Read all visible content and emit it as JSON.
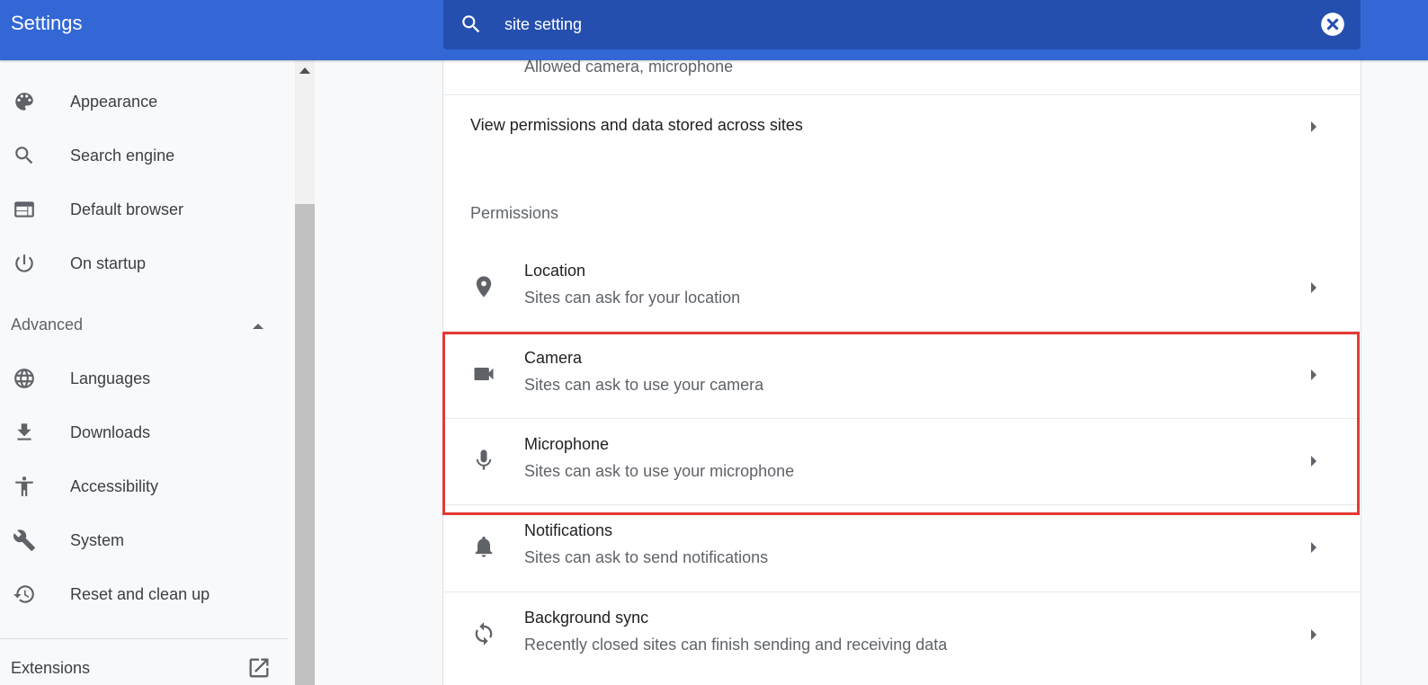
{
  "header": {
    "title": "Settings",
    "search_value": "site setting"
  },
  "sidebar": {
    "items_top": [
      {
        "label": "Appearance",
        "icon": "palette-icon"
      },
      {
        "label": "Search engine",
        "icon": "search-icon"
      },
      {
        "label": "Default browser",
        "icon": "browser-icon"
      },
      {
        "label": "On startup",
        "icon": "power-icon"
      }
    ],
    "advanced_label": "Advanced",
    "items_advanced": [
      {
        "label": "Languages",
        "icon": "globe-icon"
      },
      {
        "label": "Downloads",
        "icon": "download-icon"
      },
      {
        "label": "Accessibility",
        "icon": "accessibility-icon"
      },
      {
        "label": "System",
        "icon": "wrench-icon"
      },
      {
        "label": "Reset and clean up",
        "icon": "history-icon"
      }
    ],
    "extensions_label": "Extensions"
  },
  "main": {
    "partial_subtitle": "Allowed camera, microphone",
    "view_permissions_label": "View permissions and data stored across sites",
    "permissions_header": "Permissions",
    "permissions": [
      {
        "title": "Location",
        "subtitle": "Sites can ask for your location",
        "icon": "location-pin-icon"
      },
      {
        "title": "Camera",
        "subtitle": "Sites can ask to use your camera",
        "icon": "camera-icon"
      },
      {
        "title": "Microphone",
        "subtitle": "Sites can ask to use your microphone",
        "icon": "microphone-icon"
      },
      {
        "title": "Notifications",
        "subtitle": "Sites can ask to send notifications",
        "icon": "bell-icon"
      },
      {
        "title": "Background sync",
        "subtitle": "Recently closed sites can finish sending and receiving data",
        "icon": "sync-icon"
      }
    ]
  },
  "colors": {
    "header_bg": "#3367d6",
    "search_bg": "#254fae",
    "highlight_border": "#e53935"
  }
}
